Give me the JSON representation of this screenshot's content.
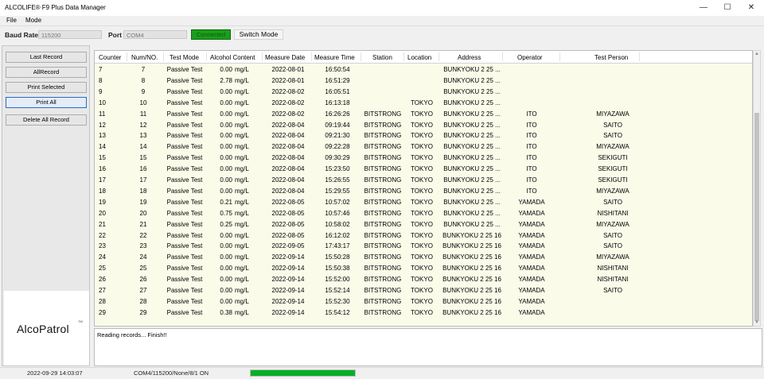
{
  "window": {
    "title": "ALCOLIFE® F9 Plus Data Manager",
    "minimize": "—",
    "maximize": "☐",
    "close": "✕"
  },
  "menu": {
    "file": "File",
    "mode": "Mode"
  },
  "toolbar": {
    "baud_label": "Baud Rate",
    "baud_value": "115200",
    "port_label": "Port",
    "port_value": "COM4",
    "connected_label": "Connected",
    "switch_mode": "Switch Mode",
    "status_color": "#1b9e1b"
  },
  "sidebar": {
    "buttons": [
      "Last Record",
      "AllRecord",
      "Print Selected",
      "Print All",
      "Delete All Record"
    ],
    "logo": "AlcoPatrol",
    "logo_tm": "TM"
  },
  "table": {
    "columns": [
      "Counter",
      "Num/NO.",
      "Test Mode",
      "Alcohol Content",
      "Measure Date",
      "Measure Time",
      "Station",
      "Location",
      "Address",
      "Operator",
      "Test Person"
    ],
    "rows": [
      [
        "7",
        "7",
        "Passive Test",
        "0.00",
        "mg/L",
        "2022-08-01",
        "16:50:54",
        "",
        "",
        "BUNKYOKU 2 25 ...",
        "",
        ""
      ],
      [
        "8",
        "8",
        "Passive Test",
        "2.78",
        "mg/L",
        "2022-08-01",
        "16:51:29",
        "",
        "",
        "BUNKYOKU 2 25 ...",
        "",
        ""
      ],
      [
        "9",
        "9",
        "Passive Test",
        "0.00",
        "mg/L",
        "2022-08-02",
        "16:05:51",
        "",
        "",
        "BUNKYOKU 2 25 ...",
        "",
        ""
      ],
      [
        "10",
        "10",
        "Passive Test",
        "0.00",
        "mg/L",
        "2022-08-02",
        "16:13:18",
        "",
        "TOKYO",
        "BUNKYOKU 2 25 ...",
        "",
        ""
      ],
      [
        "11",
        "11",
        "Passive Test",
        "0.00",
        "mg/L",
        "2022-08-02",
        "16:26:26",
        "BITSTRONG",
        "TOKYO",
        "BUNKYOKU 2 25 ...",
        "ITO",
        "MIYAZAWA"
      ],
      [
        "12",
        "12",
        "Passive Test",
        "0.00",
        "mg/L",
        "2022-08-04",
        "09:19:44",
        "BITSTRONG",
        "TOKYO",
        "BUNKYOKU 2 25 ...",
        "ITO",
        "SAITO"
      ],
      [
        "13",
        "13",
        "Passive Test",
        "0.00",
        "mg/L",
        "2022-08-04",
        "09:21:30",
        "BITSTRONG",
        "TOKYO",
        "BUNKYOKU 2 25 ...",
        "ITO",
        "SAITO"
      ],
      [
        "14",
        "14",
        "Passive Test",
        "0.00",
        "mg/L",
        "2022-08-04",
        "09:22:28",
        "BITSTRONG",
        "TOKYO",
        "BUNKYOKU 2 25 ...",
        "ITO",
        "MIYAZAWA"
      ],
      [
        "15",
        "15",
        "Passive Test",
        "0.00",
        "mg/L",
        "2022-08-04",
        "09:30:29",
        "BITSTRONG",
        "TOKYO",
        "BUNKYOKU 2 25 ...",
        "ITO",
        "SEKIGUTI"
      ],
      [
        "16",
        "16",
        "Passive Test",
        "0.00",
        "mg/L",
        "2022-08-04",
        "15:23:50",
        "BITSTRONG",
        "TOKYO",
        "BUNKYOKU 2 25 ...",
        "ITO",
        "SEKIGUTI"
      ],
      [
        "17",
        "17",
        "Passive Test",
        "0.00",
        "mg/L",
        "2022-08-04",
        "15:26:55",
        "BITSTRONG",
        "TOKYO",
        "BUNKYOKU 2 25 ...",
        "ITO",
        "SEKIGUTI"
      ],
      [
        "18",
        "18",
        "Passive Test",
        "0.00",
        "mg/L",
        "2022-08-04",
        "15:29:55",
        "BITSTRONG",
        "TOKYO",
        "BUNKYOKU 2 25 ...",
        "ITO",
        "MIYAZAWA"
      ],
      [
        "19",
        "19",
        "Passive Test",
        "0.21",
        "mg/L",
        "2022-08-05",
        "10:57:02",
        "BITSTRONG",
        "TOKYO",
        "BUNKYOKU 2 25 ...",
        "YAMADA",
        "SAITO"
      ],
      [
        "20",
        "20",
        "Passive Test",
        "0.75",
        "mg/L",
        "2022-08-05",
        "10:57:46",
        "BITSTRONG",
        "TOKYO",
        "BUNKYOKU 2 25 ...",
        "YAMADA",
        "NISHITANI"
      ],
      [
        "21",
        "21",
        "Passive Test",
        "0.25",
        "mg/L",
        "2022-08-05",
        "10:58:02",
        "BITSTRONG",
        "TOKYO",
        "BUNKYOKU 2 25 ...",
        "YAMADA",
        "MIYAZAWA"
      ],
      [
        "22",
        "22",
        "Passive Test",
        "0.00",
        "mg/L",
        "2022-08-05",
        "16:12:02",
        "BITSTRONG",
        "TOKYO",
        "BUNKYOKU 2 25 16",
        "YAMADA",
        "SAITO"
      ],
      [
        "23",
        "23",
        "Passive Test",
        "0.00",
        "mg/L",
        "2022-09-05",
        "17:43:17",
        "BITSTRONG",
        "TOKYO",
        "BUNKYOKU 2 25 16",
        "YAMADA",
        "SAITO"
      ],
      [
        "24",
        "24",
        "Passive Test",
        "0.00",
        "mg/L",
        "2022-09-14",
        "15:50:28",
        "BITSTRONG",
        "TOKYO",
        "BUNKYOKU 2 25 16",
        "YAMADA",
        "MIYAZAWA"
      ],
      [
        "25",
        "25",
        "Passive Test",
        "0.00",
        "mg/L",
        "2022-09-14",
        "15:50:38",
        "BITSTRONG",
        "TOKYO",
        "BUNKYOKU 2 25 16",
        "YAMADA",
        "NISHITANI"
      ],
      [
        "26",
        "26",
        "Passive Test",
        "0.00",
        "mg/L",
        "2022-09-14",
        "15:52:00",
        "BITSTRONG",
        "TOKYO",
        "BUNKYOKU 2 25 16",
        "YAMADA",
        "NISHITANI"
      ],
      [
        "27",
        "27",
        "Passive Test",
        "0.00",
        "mg/L",
        "2022-09-14",
        "15:52:14",
        "BITSTRONG",
        "TOKYO",
        "BUNKYOKU 2 25 16",
        "YAMADA",
        "SAITO"
      ],
      [
        "28",
        "28",
        "Passive Test",
        "0.00",
        "mg/L",
        "2022-09-14",
        "15:52:30",
        "BITSTRONG",
        "TOKYO",
        "BUNKYOKU 2 25 16",
        "YAMADA",
        ""
      ],
      [
        "29",
        "29",
        "Passive Test",
        "0.38",
        "mg/L",
        "2022-09-14",
        "15:54:12",
        "BITSTRONG",
        "TOKYO",
        "BUNKYOKU 2 25 16",
        "YAMADA",
        ""
      ]
    ]
  },
  "log": {
    "text": "Reading records... Finish!!"
  },
  "status": {
    "datetime": "2022-09-29 14:03:07",
    "connection": "COM4/115200/None/8/1 ON",
    "progress": 1.0,
    "progress_color": "#06b025"
  }
}
